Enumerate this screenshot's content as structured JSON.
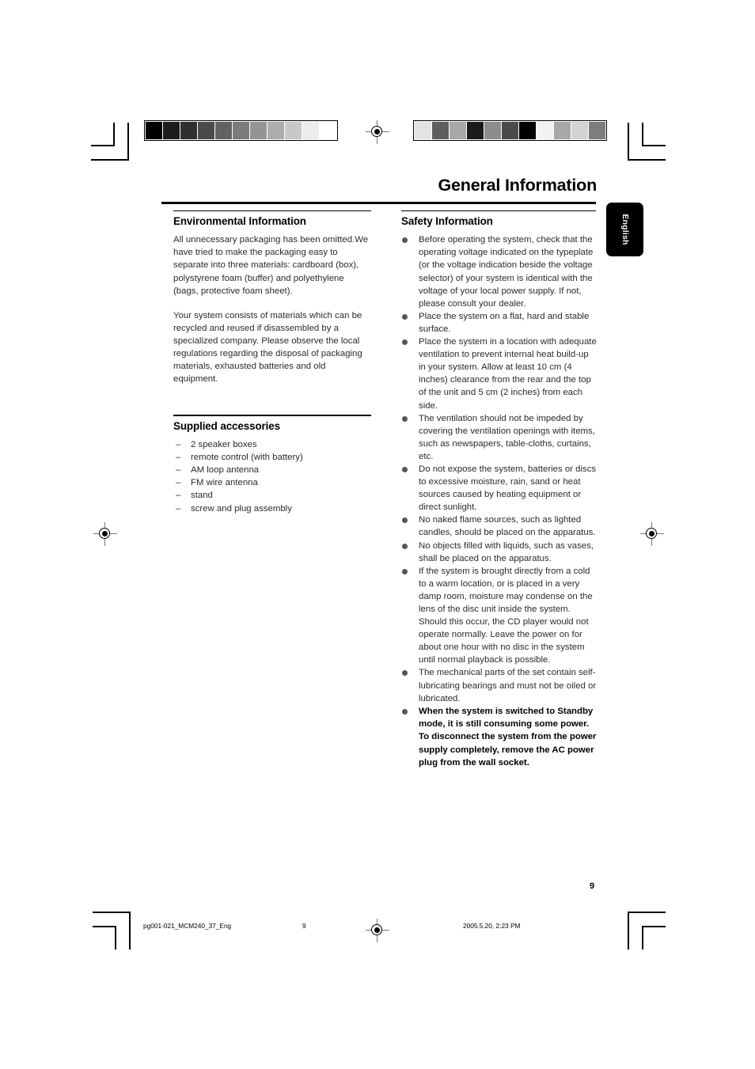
{
  "document": {
    "title": "General Information",
    "language_tab": "English",
    "page_number": "9"
  },
  "swatch_bars": {
    "left": {
      "name": "grayscale-gradient-bar",
      "colors": [
        "#000000",
        "#1c1c1c",
        "#303030",
        "#4a4a4a",
        "#626262",
        "#7b7b7b",
        "#949494",
        "#adadad",
        "#c8c8c8",
        "#ececec",
        "#ffffff"
      ]
    },
    "right": {
      "name": "grayscale-random-bar",
      "colors": [
        "#e3e3e3",
        "#5e5e5e",
        "#a8a8a8",
        "#1a1a1a",
        "#8d8d8d",
        "#4a4a4a",
        "#000000",
        "#f2f2f2",
        "#a8a8a8",
        "#d4d4d4",
        "#7d7d7d"
      ]
    }
  },
  "left_column": {
    "environmental": {
      "heading": "Environmental Information",
      "paragraphs": [
        "All unnecessary packaging has been omitted.We have tried to make the packaging easy to separate into three materials: cardboard (box), polystyrene foam (buffer) and polyethylene (bags, protective foam sheet).",
        "Your system consists of materials which can be recycled and reused if disassembled by a specialized company. Please observe the local regulations regarding the disposal of packaging materials, exhausted batteries and old equipment."
      ]
    },
    "accessories": {
      "heading": "Supplied accessories",
      "dash": "–",
      "items": [
        "2 speaker boxes",
        "remote control (with battery)",
        "AM loop antenna",
        "FM wire antenna",
        "stand",
        "screw and plug assembly"
      ]
    }
  },
  "right_column": {
    "safety": {
      "heading": "Safety Information",
      "bullets": [
        {
          "text": "Before operating the system, check that the operating voltage indicated on the typeplate (or the voltage indication beside the voltage selector) of your system is identical with the voltage of your local power supply. If not, please consult your dealer.",
          "emphasis": false
        },
        {
          "text": "Place the system on a flat, hard and stable surface.",
          "emphasis": false
        },
        {
          "text": "Place the system in a location with adequate ventilation to prevent internal heat build-up in your system.  Allow at least 10 cm (4 inches) clearance from the rear and the top of the unit and 5 cm (2 inches) from each side.",
          "emphasis": false
        },
        {
          "text": "The ventilation should not be impeded by covering the ventilation openings with items, such as newspapers, table-cloths, curtains, etc.",
          "emphasis": false
        },
        {
          "text": "Do not expose the system, batteries or discs to excessive moisture, rain, sand or heat sources caused by heating equipment or direct sunlight.",
          "emphasis": false
        },
        {
          "text": "No naked flame sources, such as lighted candles, should be placed on the apparatus.",
          "emphasis": false
        },
        {
          "text": "No objects filled with liquids, such as vases, shall be placed on the apparatus.",
          "emphasis": false
        },
        {
          "text": "If the system is brought directly from a cold to a warm location, or is placed in a very damp room, moisture may condense on the lens of the disc unit inside the system. Should this occur, the CD player would not operate normally. Leave the power on for about one hour with no disc in the system until normal playback is possible.",
          "emphasis": false
        },
        {
          "text": "The mechanical parts of the set contain self-lubricating bearings and must not be oiled or lubricated.",
          "emphasis": false
        },
        {
          "text": "When the system is switched to Standby mode, it is still consuming some power. To disconnect the system from the power supply completely, remove the AC power plug from the wall socket.",
          "emphasis": true
        }
      ]
    }
  },
  "footer": {
    "file_name": "pg001-021_MCM240_37_Eng",
    "page": "9",
    "timestamp": "2005.5.20, 2:23 PM"
  }
}
